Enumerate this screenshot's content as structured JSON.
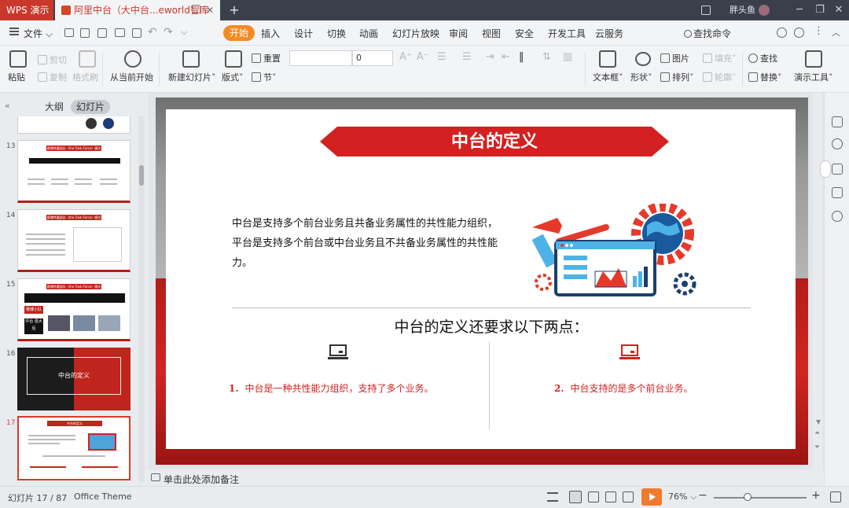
{
  "titlebar": {
    "app_tab": "WPS 演示",
    "doc_tab": "阿里中台（大中台...eworld智库",
    "user_name": "胖头鱼",
    "new_tab_symbol": "+",
    "close_symbol": "✕"
  },
  "menubar": {
    "file_label": "文件",
    "tabs": [
      "开始",
      "插入",
      "设计",
      "切换",
      "动画",
      "幻灯片放映",
      "审阅",
      "视图",
      "安全",
      "开发工具",
      "云服务"
    ],
    "active_tab": "开始",
    "search_label": "查找命令"
  },
  "ribbon": {
    "paste": "粘贴",
    "cut": "剪切",
    "copy": "复制",
    "format_painter": "格式刷",
    "from_current": "从当前开始",
    "new_slide": "新建幻灯片",
    "layout": "版式",
    "reset": "重置",
    "section": "节",
    "font_size_value": "0",
    "textbox": "文本框",
    "shape": "形状",
    "picture": "图片",
    "arrange": "排列",
    "fill": "填充",
    "outline": "轮廓",
    "find": "查找",
    "replace": "替换",
    "presentation_tools": "演示工具"
  },
  "leftpanel": {
    "tab_outline": "大纲",
    "tab_slides": "幻灯片",
    "thumbnails": [
      {
        "num": "13",
        "title": "赛博特遣部队（the Task Force）模式"
      },
      {
        "num": "14",
        "title": "赛博特遣部队（the Task Force）模式"
      },
      {
        "num": "15",
        "title": "赛博特遣部队（the Task Force）模式",
        "tag1": "赛博小队",
        "tag2": "中台\n强大后"
      },
      {
        "num": "16",
        "title": "中台的定义"
      },
      {
        "num": "17",
        "title": "中台的定义"
      }
    ]
  },
  "slide": {
    "title": "中台的定义",
    "paragraph": "中台是支持多个前台业务且共备业务属性的共性能力组织，平台是支持多个前台或中台业务且不共备业务属性的共性能力。",
    "subhead": "中台的定义还要求以下两点：",
    "point1_num": "1.",
    "point1": "中台是一种共性能力组织，支持了多个业务。",
    "point2_num": "2.",
    "point2": "中台支持的是多个前台业务。"
  },
  "notes": {
    "placeholder": "单击此处添加备注"
  },
  "statusbar": {
    "slide_counter": "幻灯片 17 / 87",
    "theme": "Office Theme",
    "zoom": "76%",
    "zoom_minus": "−",
    "zoom_plus": "+"
  },
  "colors": {
    "accent_red": "#c9382a",
    "banner_red": "#d42020",
    "active_tab": "#f58a22"
  }
}
